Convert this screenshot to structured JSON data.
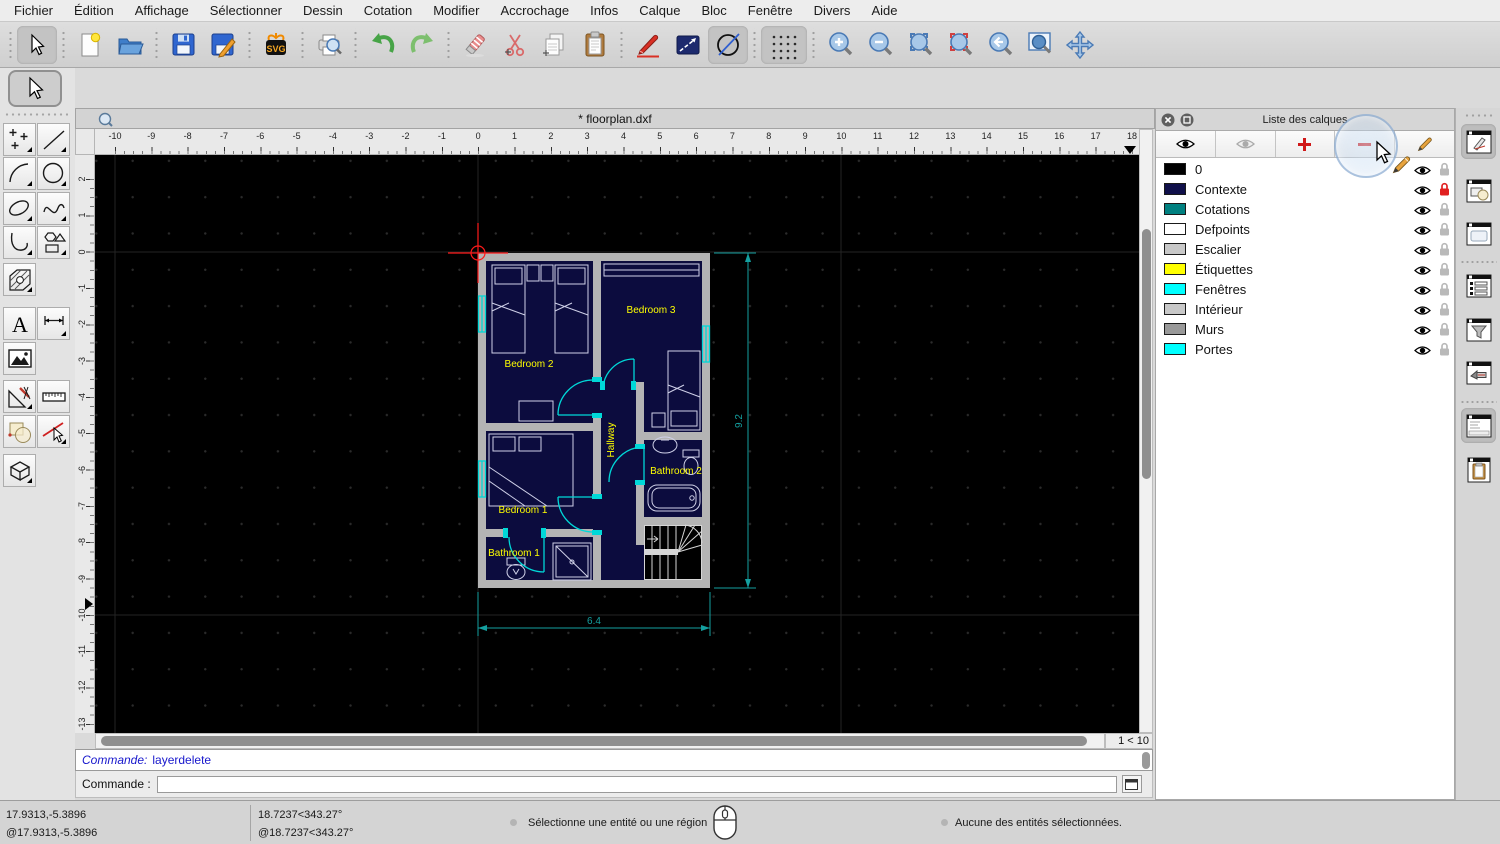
{
  "menu": {
    "items": [
      "Fichier",
      "Édition",
      "Affichage",
      "Sélectionner",
      "Dessin",
      "Cotation",
      "Modifier",
      "Accrochage",
      "Infos",
      "Calque",
      "Bloc",
      "Fenêtre",
      "Divers",
      "Aide"
    ]
  },
  "toolbar": {
    "svg_label": "SVG"
  },
  "palette": {
    "text_tool_glyph": "A"
  },
  "document": {
    "title": "* floorplan.dxf",
    "page_indicator": "1 < 10"
  },
  "rulers": {
    "horizontal": [
      "-10",
      "-9",
      "-8",
      "-7",
      "-6",
      "-5",
      "-4",
      "-3",
      "-2",
      "-1",
      "0",
      "1",
      "2",
      "3",
      "4",
      "5",
      "6",
      "7",
      "8",
      "9",
      "10",
      "11",
      "12",
      "13",
      "14",
      "15",
      "16",
      "17",
      "18"
    ],
    "vertical": [
      "2",
      "1",
      "0",
      "-1",
      "-2",
      "-3",
      "-4",
      "-5",
      "-6",
      "-7",
      "-8",
      "-9",
      "-10",
      "-11",
      "-12",
      "-13"
    ]
  },
  "floorplan": {
    "labels": {
      "bedroom2": "Bedroom 2",
      "bedroom3": "Bedroom 3",
      "hallway": "Hallway",
      "bedroom1": "Bedroom 1",
      "bathroom1": "Bathroom 1",
      "bathroom2": "Bathroom 2"
    },
    "dimensions": {
      "width": "6.4",
      "height": "9.2"
    },
    "colors": {
      "walls": "#b4b4b4",
      "interior": "#0c0c3e",
      "labels": "#ffff00",
      "doors_windows": "#00d8d8",
      "dimensions": "#14a0a0",
      "furniture": "#cfd0e8",
      "stairs_lines": "#d6d6d6",
      "crosshair": "#ff1a1a"
    }
  },
  "layers_panel": {
    "title": "Liste des calques",
    "layers": [
      {
        "name": "0",
        "color": "#000000",
        "locked": false,
        "lock_color": "#b9b9b9"
      },
      {
        "name": "Contexte",
        "color": "#10104a",
        "locked": true,
        "lock_color": "#e02020"
      },
      {
        "name": "Cotations",
        "color": "#008080",
        "locked": false,
        "lock_color": "#b9b9b9"
      },
      {
        "name": "Defpoints",
        "color": "#ffffff",
        "locked": false,
        "lock_color": "#b9b9b9"
      },
      {
        "name": "Escalier",
        "color": "#c8c8c8",
        "locked": false,
        "lock_color": "#b9b9b9"
      },
      {
        "name": "Étiquettes",
        "color": "#ffff00",
        "locked": false,
        "lock_color": "#b9b9b9"
      },
      {
        "name": "Fenêtres",
        "color": "#00ffff",
        "locked": false,
        "lock_color": "#b9b9b9"
      },
      {
        "name": "Intérieur",
        "color": "#c8c8c8",
        "locked": false,
        "lock_color": "#b9b9b9"
      },
      {
        "name": "Murs",
        "color": "#999999",
        "locked": false,
        "lock_color": "#b9b9b9"
      },
      {
        "name": "Portes",
        "color": "#00ffff",
        "locked": false,
        "lock_color": "#b9b9b9"
      }
    ]
  },
  "command": {
    "history_label": "Commande:",
    "history_entry": "layerdelete",
    "prompt_label": "Commande :",
    "input_value": ""
  },
  "status_bar": {
    "abs_coords": "17.9313,-5.3896",
    "rel_coords": "@17.9313,-5.3896",
    "polar_coords": "18.7237<343.27°",
    "polar_rel_coords": "@18.7237<343.27°",
    "hint": "Sélectionne une entité ou une région",
    "selection_info": "Aucune des entités sélectionnées."
  }
}
